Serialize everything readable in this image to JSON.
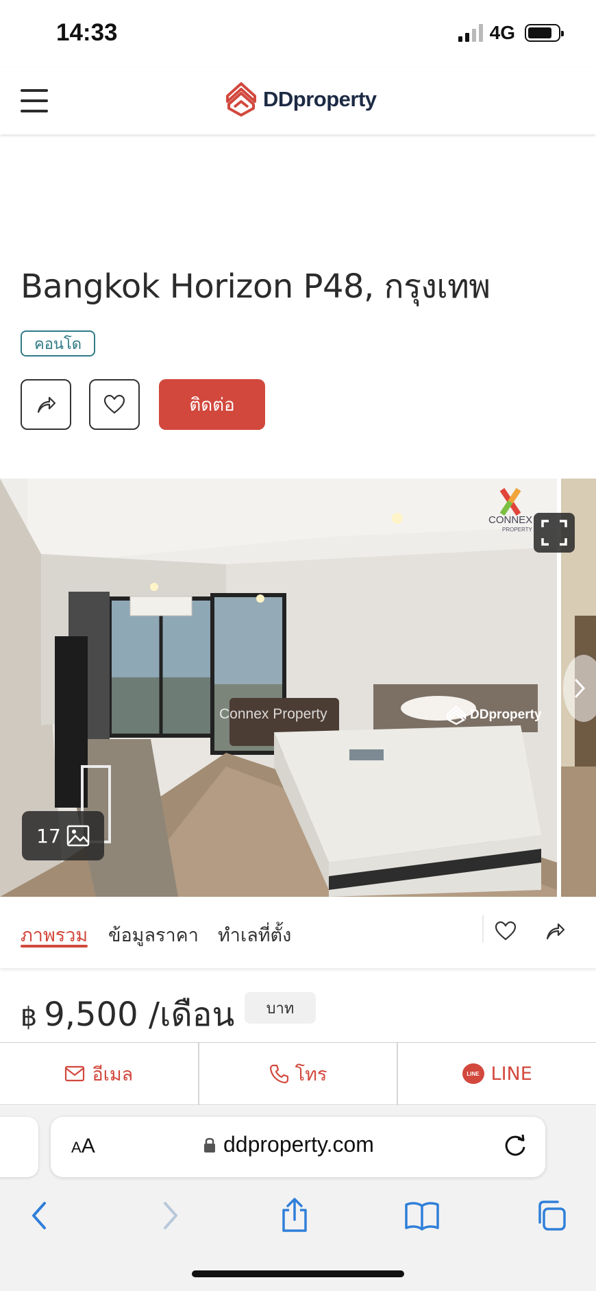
{
  "status_bar": {
    "time": "14:33",
    "network": "4G"
  },
  "header": {
    "logo_text": "DDproperty"
  },
  "listing": {
    "title": "Bangkok Horizon P48, กรุงเทพ",
    "type_badge": "คอนโด",
    "contact_label": "ติดต่อ"
  },
  "gallery": {
    "photo_count": "17",
    "watermark_center": "Connex Property",
    "watermark_logo": "DDproperty",
    "agent_logo_text": "CONNEX",
    "agent_logo_sub": "PROPERTY"
  },
  "tabs": [
    {
      "label": "ภาพรวม",
      "active": true
    },
    {
      "label": "ข้อมูลราคา",
      "active": false
    },
    {
      "label": "ทำเลที่ตั้ง",
      "active": false
    }
  ],
  "price": {
    "currency": "฿",
    "amount": "9,500 /เดือน",
    "unit_badge": "บาท"
  },
  "contact_bar": {
    "email_label": "อีเมล",
    "call_label": "โทร",
    "line_label": "LINE",
    "line_icon_text": "LINE"
  },
  "browser": {
    "aa_small": "A",
    "aa_large": "A",
    "url": "ddproperty.com"
  },
  "colors": {
    "brand_red": "#d2483d",
    "badge_teal": "#2f7a86",
    "safari_blue": "#2f7fd9"
  }
}
